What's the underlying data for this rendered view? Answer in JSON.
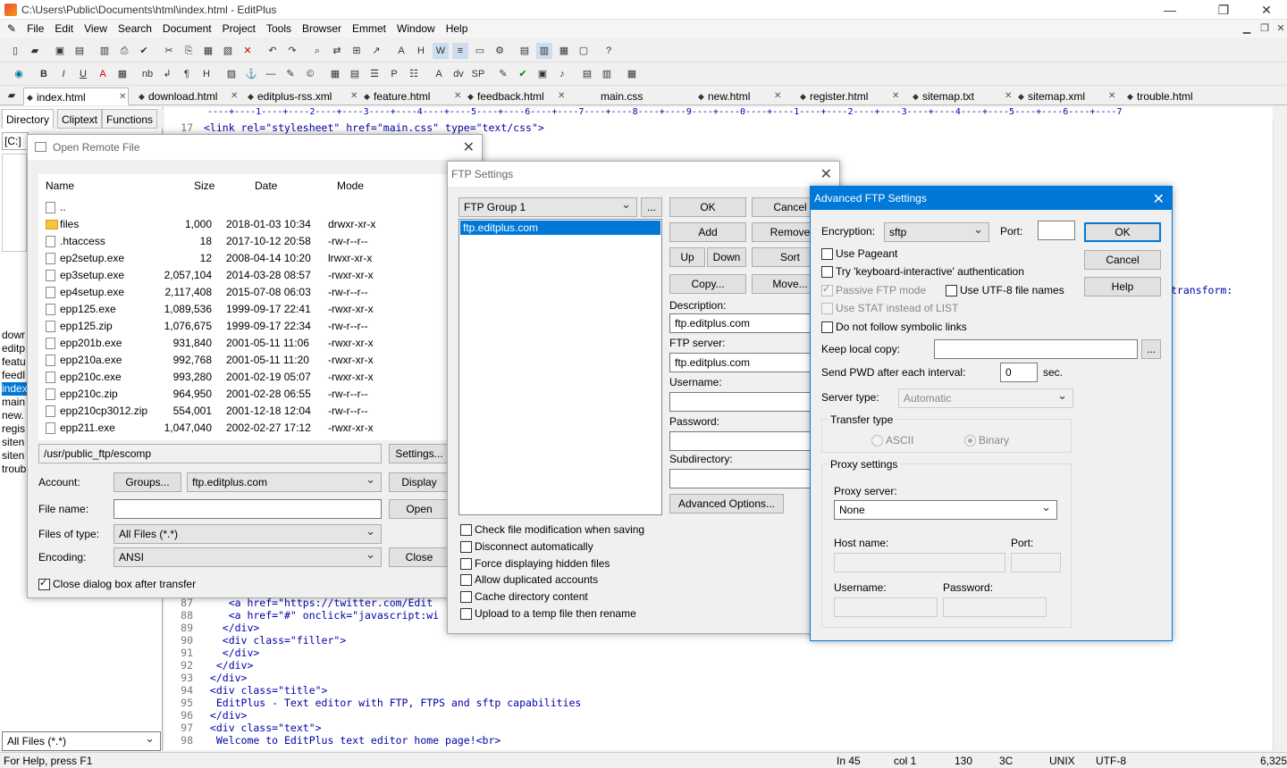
{
  "window": {
    "title": "C:\\Users\\Public\\Documents\\html\\index.html - EditPlus"
  },
  "menu": [
    "File",
    "Edit",
    "View",
    "Search",
    "Document",
    "Project",
    "Tools",
    "Browser",
    "Emmet",
    "Window",
    "Help"
  ],
  "tabs": [
    "index.html",
    "download.html",
    "editplus-rss.xml",
    "feature.html",
    "feedback.html",
    "main.css",
    "new.html",
    "register.html",
    "sitemap.txt",
    "sitemap.xml",
    "trouble.html"
  ],
  "side": {
    "tabs": [
      "Directory",
      "Cliptext",
      "Functions"
    ],
    "drive": "[C:]",
    "files": [
      "dowr",
      "editp",
      "featu",
      "feedl",
      "index",
      "main",
      "new.",
      "regis",
      "siten",
      "siten",
      "troub"
    ],
    "filter": "All Files (*.*)"
  },
  "ruler": "----+----1----+----2----+----3----+----4----+----5----+----6----+----7----+----8----+----9----+----0----+----1----+----2----+----3----+----4----+----5----+----6----+----7",
  "code": {
    "line17": {
      "num": "17",
      "text": "<link rel=\"stylesheet\" href=\"main.css\" type=\"text/css\">"
    },
    "frag": "transform:",
    "lines": [
      {
        "num": "87",
        "text": "    <a href=\"https://twitter.com/Edit"
      },
      {
        "num": "88",
        "text": "    <a href=\"#\" onclick=\"javascript:wi"
      },
      {
        "num": "89",
        "text": "   </div>"
      },
      {
        "num": "90",
        "text": "   <div class=\"filler\">"
      },
      {
        "num": "91",
        "text": "   </div>"
      },
      {
        "num": "92",
        "text": "  </div>"
      },
      {
        "num": "93",
        "text": " </div>"
      },
      {
        "num": "94",
        "text": " <div class=\"title\">"
      },
      {
        "num": "95",
        "text": "  EditPlus - Text editor with FTP, FTPS and sftp capabilities"
      },
      {
        "num": "96",
        "text": " </div>"
      },
      {
        "num": "97",
        "text": " <div class=\"text\">"
      },
      {
        "num": "98",
        "text": "  Welcome to EditPlus text editor home page!<br>"
      }
    ]
  },
  "status": {
    "help": "For Help, press F1",
    "ln": "In 45",
    "col": "col 1",
    "n1": "130",
    "hex": "3C",
    "eol": "UNIX",
    "enc": "UTF-8",
    "size": "6,325"
  },
  "remote": {
    "title": "Open Remote File",
    "cols": [
      "Name",
      "Size",
      "Date",
      "Mode"
    ],
    "rows": [
      {
        "name": "..",
        "size": "",
        "date": "",
        "mode": "",
        "type": "up"
      },
      {
        "name": "files",
        "size": "1,000",
        "date": "2018-01-03 10:34",
        "mode": "drwxr-xr-x",
        "type": "folder"
      },
      {
        "name": ".htaccess",
        "size": "18",
        "date": "2017-10-12 20:58",
        "mode": "-rw-r--r--",
        "type": "file"
      },
      {
        "name": "ep2setup.exe",
        "size": "12",
        "date": "2008-04-14 10:20",
        "mode": "lrwxr-xr-x",
        "type": "link"
      },
      {
        "name": "ep3setup.exe",
        "size": "2,057,104",
        "date": "2014-03-28 08:57",
        "mode": "-rwxr-xr-x",
        "type": "file"
      },
      {
        "name": "ep4setup.exe",
        "size": "2,117,408",
        "date": "2015-07-08 06:03",
        "mode": "-rw-r--r--",
        "type": "file"
      },
      {
        "name": "epp125.exe",
        "size": "1,089,536",
        "date": "1999-09-17 22:41",
        "mode": "-rwxr-xr-x",
        "type": "file"
      },
      {
        "name": "epp125.zip",
        "size": "1,076,675",
        "date": "1999-09-17 22:34",
        "mode": "-rw-r--r--",
        "type": "file"
      },
      {
        "name": "epp201b.exe",
        "size": "931,840",
        "date": "2001-05-11 11:06",
        "mode": "-rwxr-xr-x",
        "type": "file"
      },
      {
        "name": "epp210a.exe",
        "size": "992,768",
        "date": "2001-05-11 11:20",
        "mode": "-rwxr-xr-x",
        "type": "file"
      },
      {
        "name": "epp210c.exe",
        "size": "993,280",
        "date": "2001-02-19 05:07",
        "mode": "-rwxr-xr-x",
        "type": "file"
      },
      {
        "name": "epp210c.zip",
        "size": "964,950",
        "date": "2001-02-28 06:55",
        "mode": "-rw-r--r--",
        "type": "file"
      },
      {
        "name": "epp210cp3012.zip",
        "size": "554,001",
        "date": "2001-12-18 12:04",
        "mode": "-rw-r--r--",
        "type": "file"
      },
      {
        "name": "epp211.exe",
        "size": "1,047,040",
        "date": "2002-02-27 17:12",
        "mode": "-rwxr-xr-x",
        "type": "file"
      }
    ],
    "path": "/usr/public_ftp/escomp",
    "settings_btn": "Settings...",
    "account_label": "Account:",
    "groups_btn": "Groups...",
    "account_value": "ftp.editplus.com",
    "display_btn": "Display",
    "filename_label": "File name:",
    "open_btn": "Open",
    "type_label": "Files of type:",
    "type_value": "All Files (*.*)",
    "enc_label": "Encoding:",
    "enc_value": "ANSI",
    "close_btn": "Close",
    "close_after": "Close dialog box after transfer"
  },
  "ftp": {
    "title": "FTP Settings",
    "group": "FTP Group 1",
    "more": "...",
    "item": "ftp.editplus.com",
    "ok": "OK",
    "cancel": "Cancel",
    "add": "Add",
    "remove": "Remove",
    "up": "Up",
    "down": "Down",
    "sort": "Sort",
    "copy": "Copy...",
    "move": "Move...",
    "desc_label": "Description:",
    "desc": "ftp.editplus.com",
    "server_label": "FTP server:",
    "server": "ftp.editplus.com",
    "user_label": "Username:",
    "pass_label": "Password:",
    "subdir_label": "Subdirectory:",
    "adv_btn": "Advanced Options...",
    "checks": [
      "Check file modification when saving",
      "Disconnect automatically",
      "Force displaying hidden files",
      "Allow duplicated accounts",
      "Cache directory content",
      "Upload to a temp file then rename"
    ]
  },
  "adv": {
    "title": "Advanced FTP Settings",
    "enc_label": "Encryption:",
    "enc": "sftp",
    "port_label": "Port:",
    "ok": "OK",
    "cancel": "Cancel",
    "help": "Help",
    "pageant": "Use Pageant",
    "kbd": "Try 'keyboard-interactive' authentication",
    "passive": "Passive FTP mode",
    "utf8": "Use UTF-8 file names",
    "stat": "Use STAT instead of LIST",
    "nosym": "Do not follow symbolic links",
    "keep_label": "Keep local copy:",
    "more": "...",
    "pwd_label": "Send PWD after each interval:",
    "pwd": "0",
    "sec": "sec.",
    "stype_label": "Server type:",
    "stype": "Automatic",
    "transfer": "Transfer type",
    "ascii": "ASCII",
    "binary": "Binary",
    "proxy": "Proxy settings",
    "proxy_server": "Proxy server:",
    "proxy_value": "None",
    "host": "Host name:",
    "pport": "Port:",
    "puser": "Username:",
    "ppass": "Password:"
  }
}
